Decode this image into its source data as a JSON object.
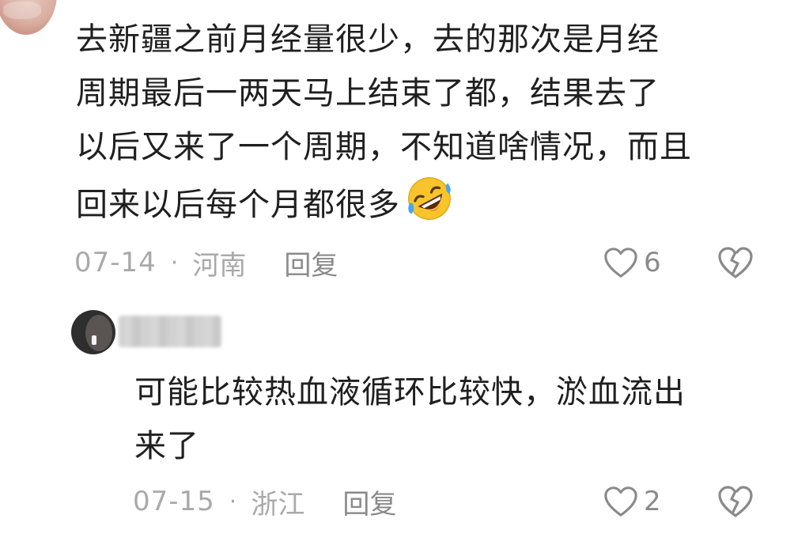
{
  "comments": [
    {
      "text": "去新疆之前月经量很少，去的那次是月经\n周期最后一两天马上结束了都，结果去了\n以后又来了一个周期，不知道啥情况，而且\n回来以后每个月都很多",
      "emoji": "rolling-on-floor-laughing-emoji",
      "date": "07-14",
      "separator": "·",
      "location": "河南",
      "reply_label": "回复",
      "like_count": "6",
      "like_icon": "heart-outline-icon",
      "dislike_icon": "broken-heart-icon"
    },
    {
      "text": "可能比较热血液循环比较快，淤血流出\n来了",
      "date": "07-15",
      "separator": "·",
      "location": "浙江",
      "reply_label": "回复",
      "like_count": "2",
      "like_icon": "heart-outline-icon",
      "dislike_icon": "broken-heart-icon"
    }
  ],
  "colors": {
    "text": "#1f1f1f",
    "meta": "#a9a9a9",
    "icon": "#8a8a8a",
    "emoji_face": "#f7c52b"
  }
}
